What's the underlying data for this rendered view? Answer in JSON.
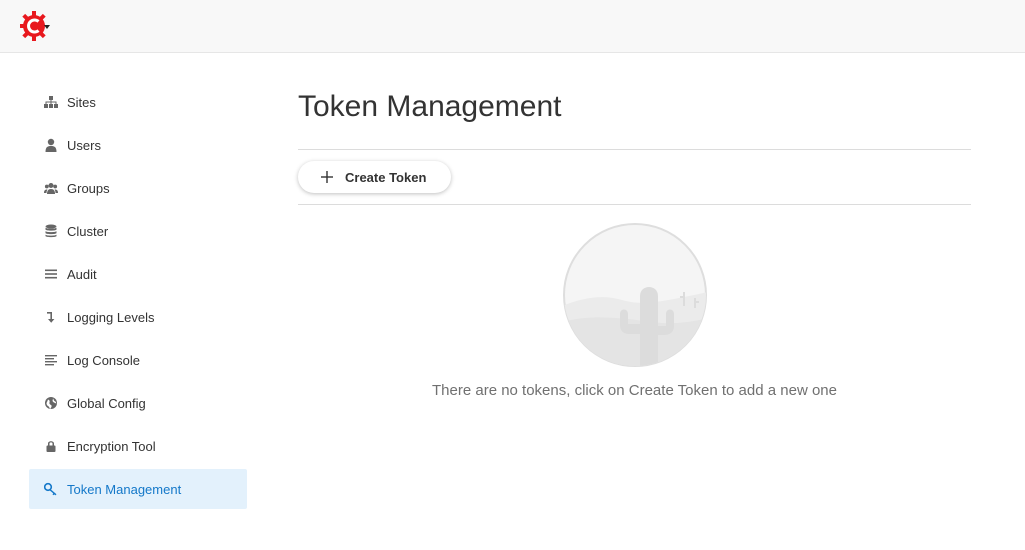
{
  "brand": {
    "accent": "#e8181e"
  },
  "sidebar": {
    "items": [
      {
        "label": "Sites",
        "icon": "sitemap-icon"
      },
      {
        "label": "Users",
        "icon": "user-icon"
      },
      {
        "label": "Groups",
        "icon": "users-icon"
      },
      {
        "label": "Cluster",
        "icon": "database-icon"
      },
      {
        "label": "Audit",
        "icon": "list-icon"
      },
      {
        "label": "Logging Levels",
        "icon": "level-down-icon"
      },
      {
        "label": "Log Console",
        "icon": "align-left-icon"
      },
      {
        "label": "Global Config",
        "icon": "globe-icon"
      },
      {
        "label": "Encryption Tool",
        "icon": "lock-icon"
      },
      {
        "label": "Token Management",
        "icon": "key-icon",
        "active": true
      }
    ]
  },
  "main": {
    "title": "Token Management",
    "create_button_label": "Create Token",
    "empty_message": "There are no tokens, click on Create Token to add a new one"
  },
  "colors": {
    "active_bg": "#e3f1fc",
    "active_text": "#1478c9"
  }
}
